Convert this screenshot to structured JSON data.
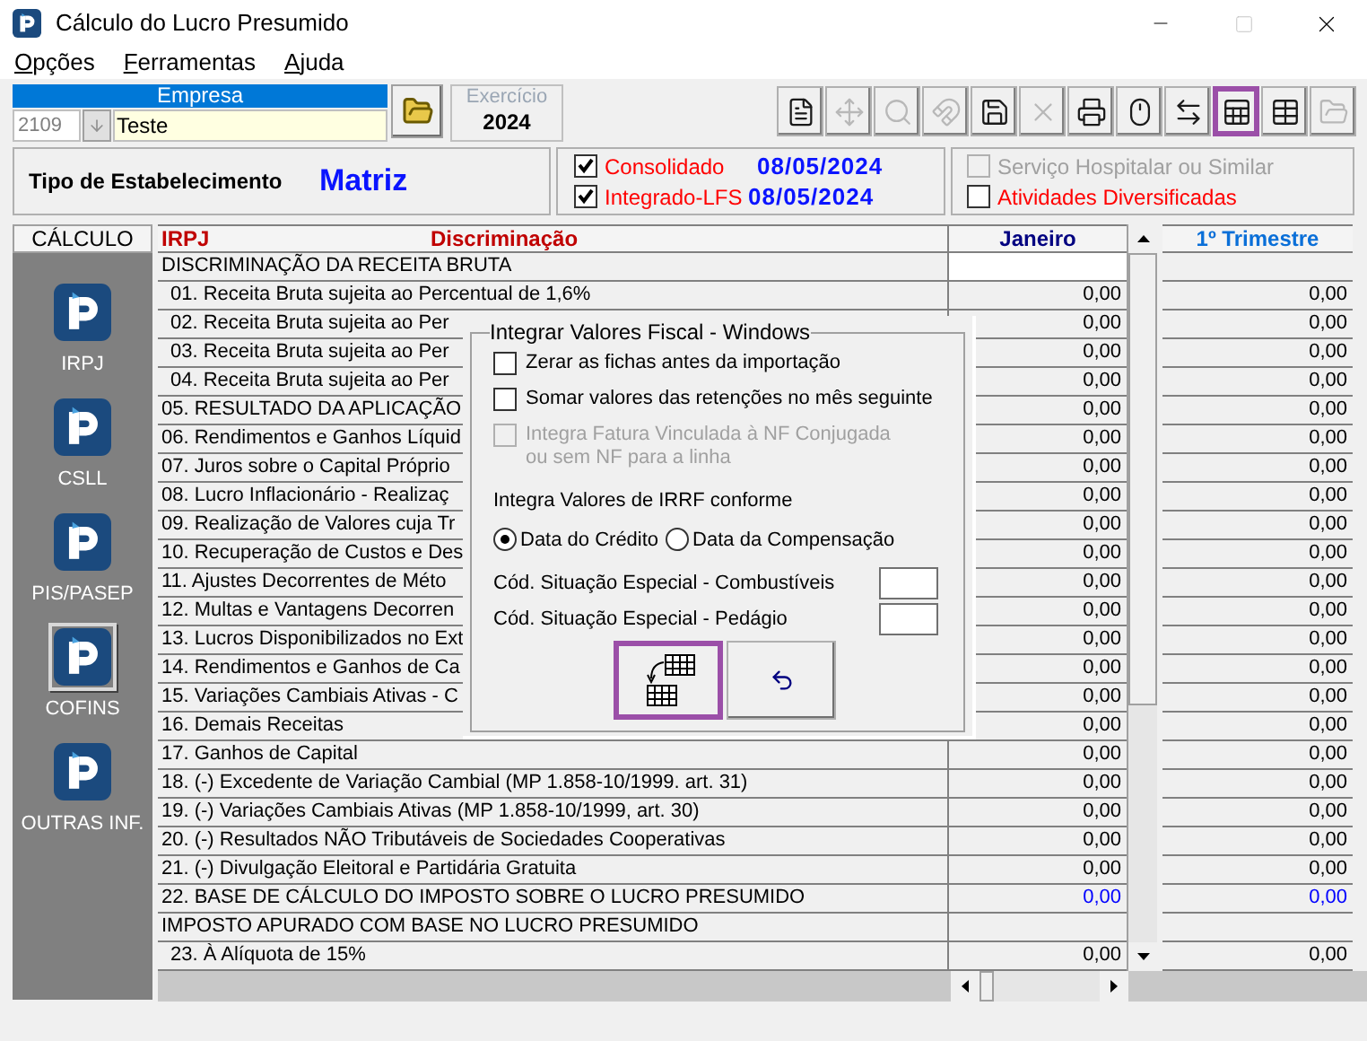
{
  "window": {
    "title": "Cálculo do Lucro Presumido"
  },
  "menu": [
    "Opções",
    "Ferramentas",
    "Ajuda"
  ],
  "toolbar": [
    {
      "disabled": false,
      "highlighted": false
    },
    {
      "disabled": true,
      "highlighted": false
    },
    {
      "disabled": true,
      "highlighted": false
    },
    {
      "disabled": true,
      "highlighted": false
    },
    {
      "disabled": false,
      "highlighted": false
    },
    {
      "disabled": true,
      "highlighted": false
    },
    {
      "disabled": false,
      "highlighted": false
    },
    {
      "disabled": false,
      "highlighted": false
    },
    {
      "disabled": false,
      "highlighted": false
    },
    {
      "disabled": false,
      "highlighted": true
    },
    {
      "disabled": false,
      "highlighted": false
    },
    {
      "disabled": true,
      "highlighted": false
    }
  ],
  "empresa": {
    "label": "Empresa",
    "code": "2109",
    "name": "Teste"
  },
  "exercicio": {
    "label": "Exercício",
    "year": "2024"
  },
  "establishment": {
    "label": "Tipo de Estabelecimento",
    "value": "Matriz"
  },
  "integration": [
    {
      "label": "Consolidado",
      "checked": true,
      "date": "08/05/2024"
    },
    {
      "label": "Integrado-LFS",
      "checked": true,
      "date": "08/05/2024"
    }
  ],
  "activities": [
    {
      "label": "Serviço Hospitalar ou Similar",
      "checked": false,
      "disabled": true
    },
    {
      "label": "Atividades Diversificadas",
      "checked": false,
      "disabled": false
    }
  ],
  "sidebar": {
    "title": "CÁLCULO",
    "items": [
      {
        "label": "IRPJ",
        "selected": false
      },
      {
        "label": "CSLL",
        "selected": false
      },
      {
        "label": "PIS/PASEP",
        "selected": false
      },
      {
        "label": "COFINS",
        "selected": true
      },
      {
        "label": "OUTRAS INF.",
        "selected": false
      }
    ]
  },
  "table": {
    "tax": "IRPJ",
    "columns": [
      "Discriminação",
      "Janeiro",
      "1º Trimestre"
    ],
    "rows": [
      {
        "kind": "section",
        "label": "DISCRIMINAÇÃO DA RECEITA BRUTA"
      },
      {
        "kind": "sub",
        "label": "01. Receita Bruta sujeita ao Percentual de 1,6%",
        "values": [
          "0,00",
          "0,00"
        ]
      },
      {
        "kind": "sub",
        "label": "02. Receita Bruta sujeita ao Per",
        "values": [
          "0,00",
          "0,00"
        ]
      },
      {
        "kind": "sub",
        "label": "03. Receita Bruta sujeita ao Per",
        "values": [
          "0,00",
          "0,00"
        ]
      },
      {
        "kind": "sub",
        "label": "04. Receita Bruta sujeita ao Per",
        "values": [
          "0,00",
          "0,00"
        ]
      },
      {
        "kind": "line",
        "label": "05. RESULTADO DA APLICAÇÃO",
        "values": [
          "0,00",
          "0,00"
        ]
      },
      {
        "kind": "line",
        "label": "06. Rendimentos e Ganhos Líquid",
        "values": [
          "0,00",
          "0,00"
        ]
      },
      {
        "kind": "line",
        "label": "07. Juros sobre o Capital Próprio",
        "values": [
          "0,00",
          "0,00"
        ]
      },
      {
        "kind": "line",
        "label": "08. Lucro Inflacionário - Realizaç",
        "values": [
          "0,00",
          "0,00"
        ]
      },
      {
        "kind": "line",
        "label": "09. Realização de Valores cuja Tr",
        "values": [
          "0,00",
          "0,00"
        ]
      },
      {
        "kind": "line",
        "label": "10. Recuperação de Custos e Des",
        "values": [
          "0,00",
          "0,00"
        ]
      },
      {
        "kind": "line",
        "label": "11. Ajustes Decorrentes de Méto",
        "values": [
          "0,00",
          "0,00"
        ]
      },
      {
        "kind": "line",
        "label": "12. Multas e Vantagens Decorren",
        "values": [
          "0,00",
          "0,00"
        ]
      },
      {
        "kind": "line",
        "label": "13. Lucros Disponibilizados no Ext",
        "values": [
          "0,00",
          "0,00"
        ]
      },
      {
        "kind": "line",
        "label": "14. Rendimentos e Ganhos de Ca",
        "values": [
          "0,00",
          "0,00"
        ]
      },
      {
        "kind": "line",
        "label": "15. Variações Cambiais Ativas - C",
        "values": [
          "0,00",
          "0,00"
        ]
      },
      {
        "kind": "line",
        "label": "16. Demais Receitas",
        "values": [
          "0,00",
          "0,00"
        ]
      },
      {
        "kind": "line",
        "label": "17. Ganhos de Capital",
        "values": [
          "0,00",
          "0,00"
        ]
      },
      {
        "kind": "line",
        "label": "18. (-) Excedente de Variação Cambial (MP 1.858-10/1999. art. 31)",
        "values": [
          "0,00",
          "0,00"
        ]
      },
      {
        "kind": "line",
        "label": "19. (-) Variações Cambiais Ativas (MP 1.858-10/1999, art. 30)",
        "values": [
          "0,00",
          "0,00"
        ]
      },
      {
        "kind": "line",
        "label": "20. (-) Resultados NÃO Tributáveis de Sociedades Cooperativas",
        "values": [
          "0,00",
          "0,00"
        ]
      },
      {
        "kind": "line",
        "label": "21. (-) Divulgação Eleitoral e Partidária Gratuita",
        "values": [
          "0,00",
          "0,00"
        ]
      },
      {
        "kind": "total",
        "label": "22. BASE DE CÁLCULO DO IMPOSTO SOBRE O LUCRO PRESUMIDO",
        "values": [
          "0,00",
          "0,00"
        ]
      },
      {
        "kind": "section",
        "label": "IMPOSTO APURADO COM BASE NO LUCRO PRESUMIDO"
      },
      {
        "kind": "sub",
        "label": "23. À Alíquota de 15%",
        "values": [
          "0,00",
          "0,00"
        ]
      }
    ]
  },
  "dialog": {
    "title": "Integrar Valores Fiscal - Windows",
    "options": [
      {
        "label": "Zerar as fichas antes da importação",
        "checked": false,
        "disabled": false
      },
      {
        "label": "Somar valores das retenções no mês seguinte",
        "checked": false,
        "disabled": false
      },
      {
        "label": "Integra Fatura Vinculada à NF Conjugada ou sem NF para a linha",
        "checked": false,
        "disabled": true
      }
    ],
    "irrf_label": "Integra Valores de IRRF conforme",
    "irrf_options": [
      {
        "label": "Data do Crédito",
        "selected": true
      },
      {
        "label": "Data da Compensação",
        "selected": false
      }
    ],
    "fields": [
      {
        "label": "Cód. Situação Especial - Combustíveis"
      },
      {
        "label": "Cód. Situação Especial - Pedágio"
      }
    ],
    "buttons": [
      {
        "kind": "import",
        "highlighted": true
      },
      {
        "kind": "undo",
        "highlighted": false
      }
    ]
  }
}
